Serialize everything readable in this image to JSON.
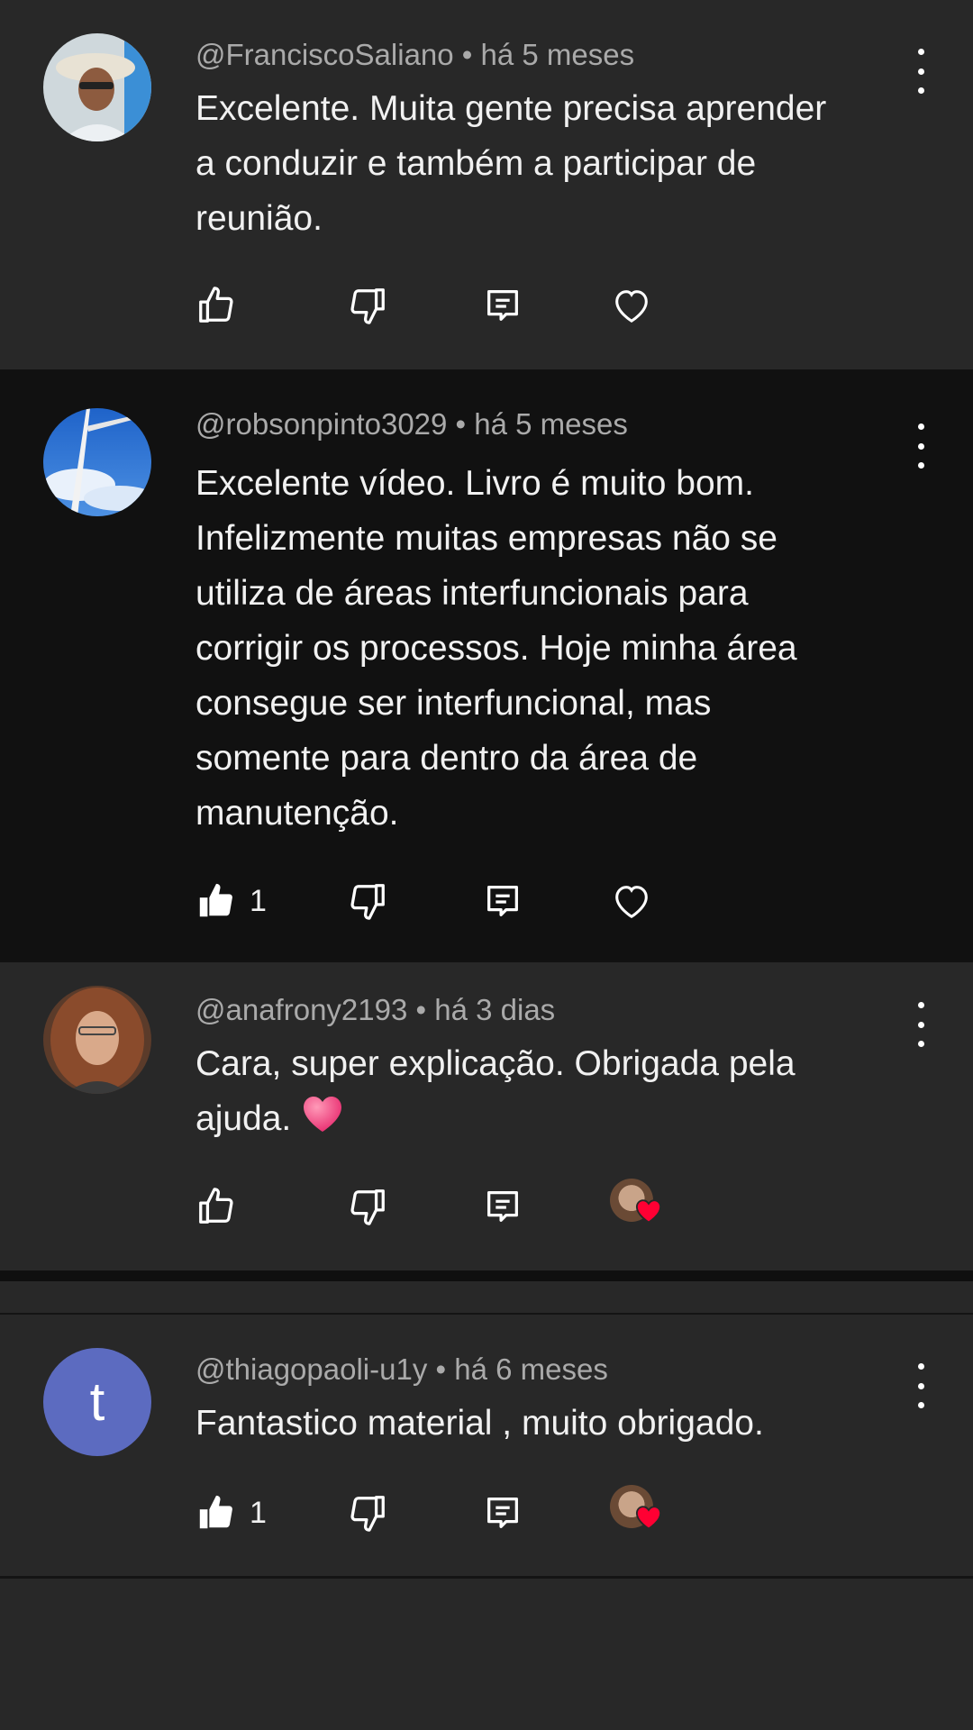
{
  "comments": [
    {
      "author": "@FranciscoSaliano",
      "time": "há 5 meses",
      "text": [
        "Excelente. Muita gente precisa aprender",
        "a conduzir e também a participar de",
        "reunião."
      ],
      "likes": "",
      "liked": false,
      "creator_heart": false
    },
    {
      "author": "@robsonpinto3029",
      "time": "há 5 meses",
      "text": [
        "Excelente vídeo. Livro é muito bom.",
        "Infelizmente muitas empresas não se",
        "utiliza de áreas interfuncionais para",
        "corrigir os processos. Hoje minha área",
        "consegue ser interfuncional, mas",
        "somente para dentro da área de",
        "manutenção."
      ],
      "likes": "1",
      "liked": true,
      "creator_heart": false
    },
    {
      "author": "@anafrony2193",
      "time": "há 3 dias",
      "text": [
        "Cara, super explicação. Obrigada pela",
        "ajuda."
      ],
      "likes": "",
      "liked": false,
      "creator_heart": true
    },
    {
      "author": "@thiagopaoli-u1y",
      "time": "há 6 meses",
      "text": [
        "Fantastico material , muito obrigado."
      ],
      "likes": "1",
      "liked": true,
      "creator_heart": true,
      "avatar_letter": "t",
      "avatar_color": "#5c6bc0"
    }
  ],
  "separator": "•"
}
